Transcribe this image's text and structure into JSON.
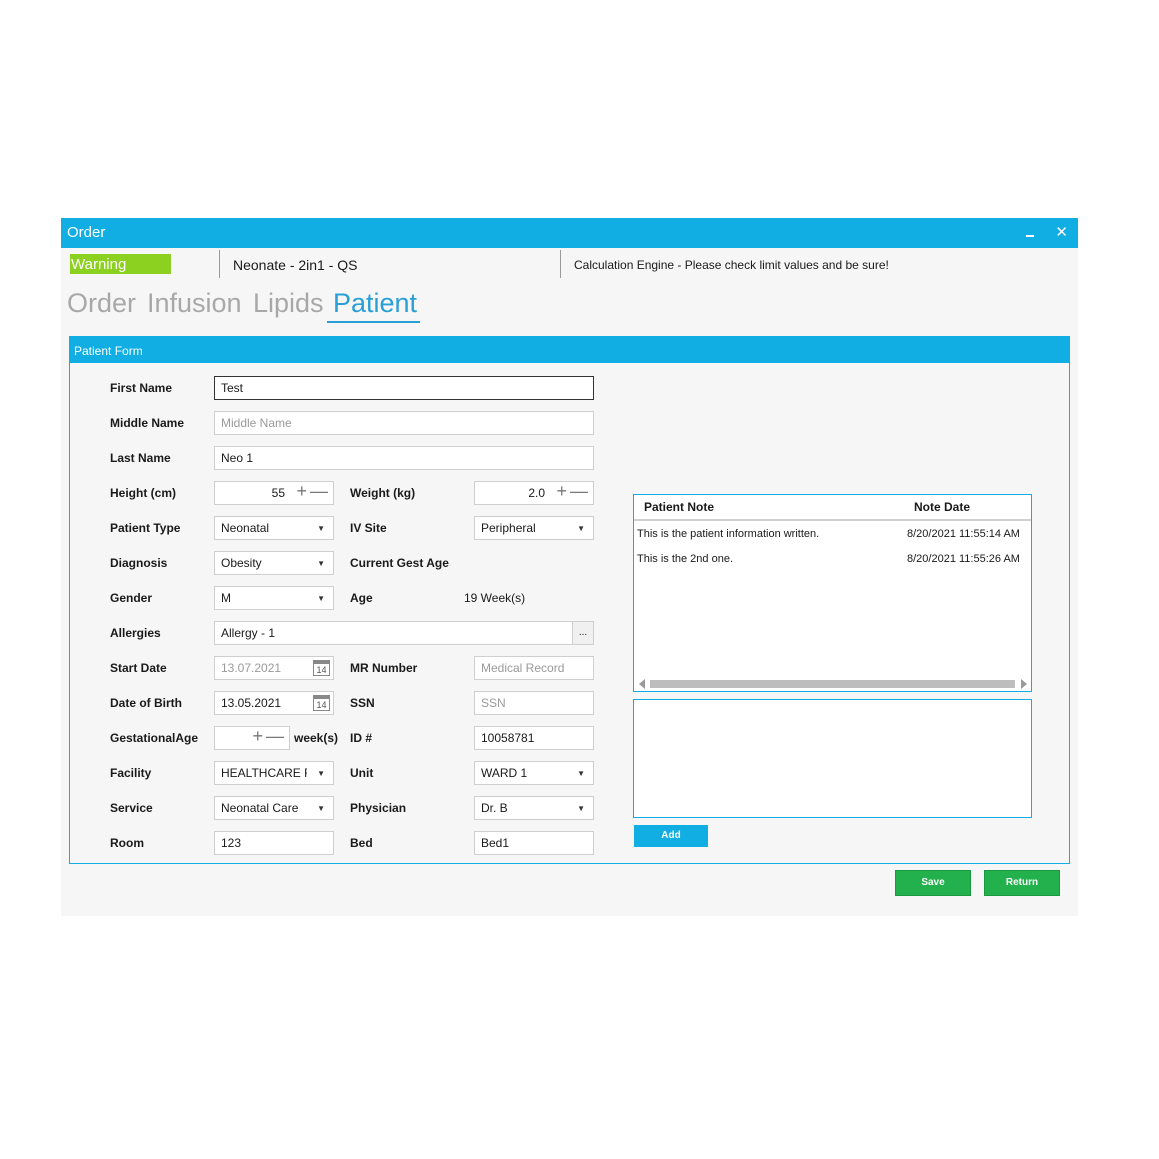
{
  "window": {
    "title": "Order",
    "close_glyph": "✕"
  },
  "header": {
    "warning": "Warning",
    "protocol": "Neonate - 2in1 - QS",
    "message": "Calculation Engine - Please check limit values and be sure!"
  },
  "tabs": [
    "Order",
    "Infusion",
    "Lipids",
    "Patient"
  ],
  "active_tab": "Patient",
  "panel": {
    "title": "Patient Form"
  },
  "form": {
    "first_name": {
      "label": "First Name",
      "value": "Test"
    },
    "middle_name": {
      "label": "Middle Name",
      "placeholder": "Middle Name"
    },
    "last_name": {
      "label": "Last Name",
      "value": "Neo 1"
    },
    "height": {
      "label": "Height (cm)",
      "value": "55"
    },
    "weight": {
      "label": "Weight (kg)",
      "value": "2.0"
    },
    "patient_type": {
      "label": "Patient Type",
      "value": "Neonatal"
    },
    "iv_site": {
      "label": "IV Site",
      "value": "Peripheral"
    },
    "diagnosis": {
      "label": "Diagnosis",
      "value": "Obesity"
    },
    "current_gest_age": {
      "label": "Current Gest Age"
    },
    "gender": {
      "label": "Gender",
      "value": "M"
    },
    "age": {
      "label": "Age",
      "value": "19 Week(s)"
    },
    "allergies": {
      "label": "Allergies",
      "value": "Allergy - 1",
      "button": "..."
    },
    "start_date": {
      "label": "Start Date",
      "value": "13.07.2021"
    },
    "mr_number": {
      "label": "MR Number",
      "placeholder": "Medical Record"
    },
    "dob": {
      "label": "Date of Birth",
      "value": "13.05.2021"
    },
    "ssn": {
      "label": "SSN",
      "placeholder": "SSN"
    },
    "gestational_age": {
      "label": "GestationalAge",
      "unit": "week(s)"
    },
    "id": {
      "label": "ID #",
      "value": "10058781"
    },
    "facility": {
      "label": "Facility",
      "value": "HEALTHCARE FA"
    },
    "unit": {
      "label": "Unit",
      "value": "WARD 1"
    },
    "service": {
      "label": "Service",
      "value": "Neonatal Care"
    },
    "physician": {
      "label": "Physician",
      "value": "Dr. B"
    },
    "room": {
      "label": "Room",
      "value": "123"
    },
    "bed": {
      "label": "Bed",
      "value": "Bed1"
    },
    "calendar_glyph": "14"
  },
  "notes": {
    "columns": [
      "Patient Note",
      "Note Date"
    ],
    "rows": [
      {
        "note": "This is the patient information written.",
        "date": "8/20/2021 11:55:14 AM"
      },
      {
        "note": "This is the 2nd one.",
        "date": "8/20/2021 11:55:26 AM"
      }
    ],
    "add_label": "Add"
  },
  "actions": {
    "save": "Save",
    "return": "Return"
  },
  "colors": {
    "accent": "#10aee3",
    "warning": "#8cd11f",
    "save": "#22b14c",
    "active_tab": "#2a9fd6"
  }
}
